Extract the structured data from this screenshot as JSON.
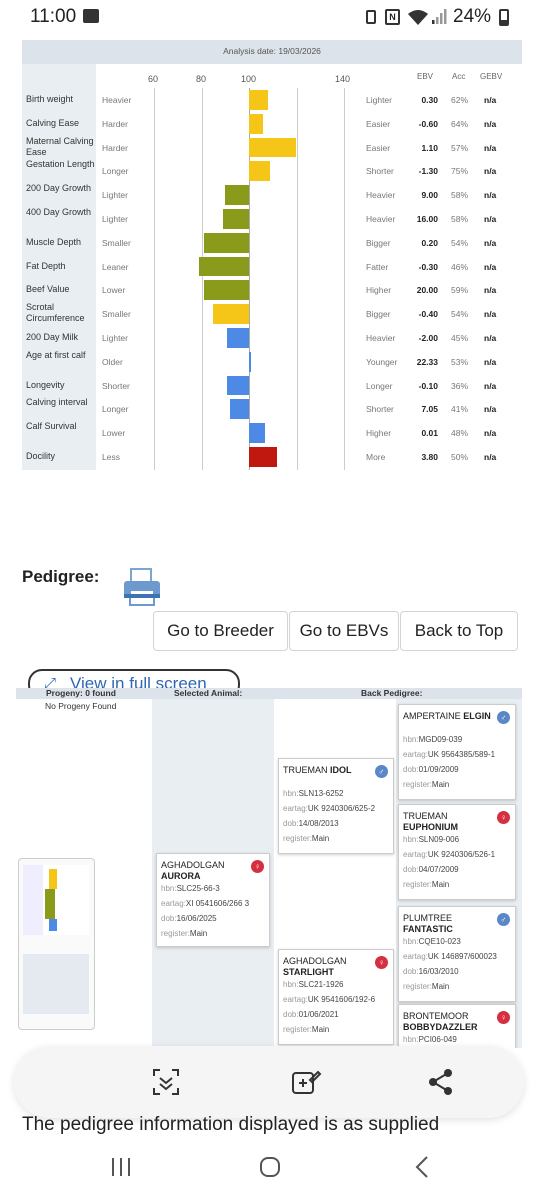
{
  "status_bar": {
    "time": "11:00",
    "battery": "24%"
  },
  "analysis": {
    "date_label": "Analysis date: 19/03/2026",
    "axis_ticks": [
      "60",
      "80",
      "100",
      "140"
    ],
    "col_headers": {
      "ebv": "EBV",
      "acc": "Acc",
      "gebv": "GEBV"
    },
    "rows": [
      {
        "trait": "Birth weight",
        "low": "Heavier",
        "high": "Lighter",
        "ebv": "0.30",
        "acc": "62%",
        "gebv": "n/a",
        "score": 108,
        "color": "#f5c518"
      },
      {
        "trait": "Calving Ease",
        "low": "Harder",
        "high": "Easier",
        "ebv": "-0.60",
        "acc": "64%",
        "gebv": "n/a",
        "score": 106,
        "color": "#f5c518"
      },
      {
        "trait": "Maternal Calving Ease",
        "low": "Harder",
        "high": "Easier",
        "ebv": "1.10",
        "acc": "57%",
        "gebv": "n/a",
        "score": 120,
        "color": "#f5c518"
      },
      {
        "trait": "Gestation Length",
        "low": "Longer",
        "high": "Shorter",
        "ebv": "-1.30",
        "acc": "75%",
        "gebv": "n/a",
        "score": 109,
        "color": "#f5c518"
      },
      {
        "trait": "200 Day Growth",
        "low": "Lighter",
        "high": "Heavier",
        "ebv": "9.00",
        "acc": "58%",
        "gebv": "n/a",
        "score": 90,
        "color": "#8a9a1b"
      },
      {
        "trait": "400 Day Growth",
        "low": "Lighter",
        "high": "Heavier",
        "ebv": "16.00",
        "acc": "58%",
        "gebv": "n/a",
        "score": 89,
        "color": "#8a9a1b"
      },
      {
        "trait": "Muscle Depth",
        "low": "Smaller",
        "high": "Bigger",
        "ebv": "0.20",
        "acc": "54%",
        "gebv": "n/a",
        "score": 81,
        "color": "#8a9a1b"
      },
      {
        "trait": "Fat Depth",
        "low": "Leaner",
        "high": "Fatter",
        "ebv": "-0.30",
        "acc": "46%",
        "gebv": "n/a",
        "score": 79,
        "color": "#8a9a1b"
      },
      {
        "trait": "Beef Value",
        "low": "Lower",
        "high": "Higher",
        "ebv": "20.00",
        "acc": "59%",
        "gebv": "n/a",
        "score": 81,
        "color": "#8a9a1b"
      },
      {
        "trait": "Scrotal Circumference",
        "low": "Smaller",
        "high": "Bigger",
        "ebv": "-0.40",
        "acc": "54%",
        "gebv": "n/a",
        "score": 85,
        "color": "#f5c518"
      },
      {
        "trait": "200 Day Milk",
        "low": "Lighter",
        "high": "Heavier",
        "ebv": "-2.00",
        "acc": "45%",
        "gebv": "n/a",
        "score": 91,
        "color": "#4d8ae6"
      },
      {
        "trait": "Age at first calf",
        "low": "Older",
        "high": "Younger",
        "ebv": "22.33",
        "acc": "53%",
        "gebv": "n/a",
        "score": 101,
        "color": "#4d8ae6"
      },
      {
        "trait": "Longevity",
        "low": "Shorter",
        "high": "Longer",
        "ebv": "-0.10",
        "acc": "36%",
        "gebv": "n/a",
        "score": 91,
        "color": "#4d8ae6"
      },
      {
        "trait": "Calving interval",
        "low": "Longer",
        "high": "Shorter",
        "ebv": "7.05",
        "acc": "41%",
        "gebv": "n/a",
        "score": 92,
        "color": "#4d8ae6"
      },
      {
        "trait": "Calf Survival",
        "low": "Lower",
        "high": "Higher",
        "ebv": "0.01",
        "acc": "48%",
        "gebv": "n/a",
        "score": 107,
        "color": "#4d8ae6"
      },
      {
        "trait": "Docility",
        "low": "Less",
        "high": "More",
        "ebv": "3.80",
        "acc": "50%",
        "gebv": "n/a",
        "score": 112,
        "color": "#c0170f"
      }
    ]
  },
  "pedigree": {
    "title": "Pedigree:",
    "buttons": {
      "breeder": "Go to Breeder",
      "ebvs": "Go to EBVs",
      "top": "Back to Top"
    },
    "view_full_screen": "View in full screen",
    "headers": {
      "progeny": "Progeny: 0 found",
      "selected": "Selected Animal:",
      "back": "Back Pedigree:"
    },
    "no_progeny": "No Progeny Found",
    "labels": {
      "hbn": "hbn:",
      "eartag": "eartag:",
      "dob": "dob:",
      "register": "register:"
    },
    "selected": {
      "prefix": "AGHADOLGAN",
      "name": "AURORA",
      "sex": "female",
      "hbn": "SLC25-66-3",
      "eartag": "XI 0541606/266 3",
      "dob": "16/06/2025",
      "register": "Main"
    },
    "sire": {
      "prefix": "TRUEMAN",
      "name": "IDOL",
      "sex": "male",
      "hbn": "SLN13-6252",
      "eartag": "UK 9240306/625-2",
      "dob": "14/08/2013",
      "register": "Main"
    },
    "dam": {
      "prefix": "AGHADOLGAN",
      "name": "STARLIGHT",
      "sex": "female",
      "hbn": "SLC21-1926",
      "eartag": "UK 9541606/192-6",
      "dob": "01/06/2021",
      "register": "Main"
    },
    "ss": {
      "prefix": "AMPERTAINE",
      "name": "ELGIN",
      "sex": "male",
      "hbn": "MGD09-039",
      "eartag": "UK 9564385/589-1",
      "dob": "01/09/2009",
      "register": "Main"
    },
    "sd": {
      "prefix": "TRUEMAN",
      "name": "EUPHONIUM",
      "sex": "female",
      "hbn": "SLN09-006",
      "eartag": "UK 9240306/526-1",
      "dob": "04/07/2009",
      "register": "Main"
    },
    "ds": {
      "prefix": "PLUMTREE",
      "name": "FANTASTIC",
      "sex": "male",
      "hbn": "CQE10-023",
      "eartag": "UK 146897/600023",
      "dob": "16/03/2010",
      "register": "Main"
    },
    "dd": {
      "prefix": "BRONTEMOOR",
      "name": "BOBBYDAZZLER",
      "sex": "female",
      "hbn": "PCI06-049"
    }
  },
  "footer_text": "The pedigree information displayed is as supplied",
  "icons": {
    "status_image": "image-icon",
    "lens": "lens-scan-icon",
    "edit": "add-edit-icon",
    "share": "share-icon",
    "printer": "printer-icon",
    "expand": "expand-icon"
  }
}
